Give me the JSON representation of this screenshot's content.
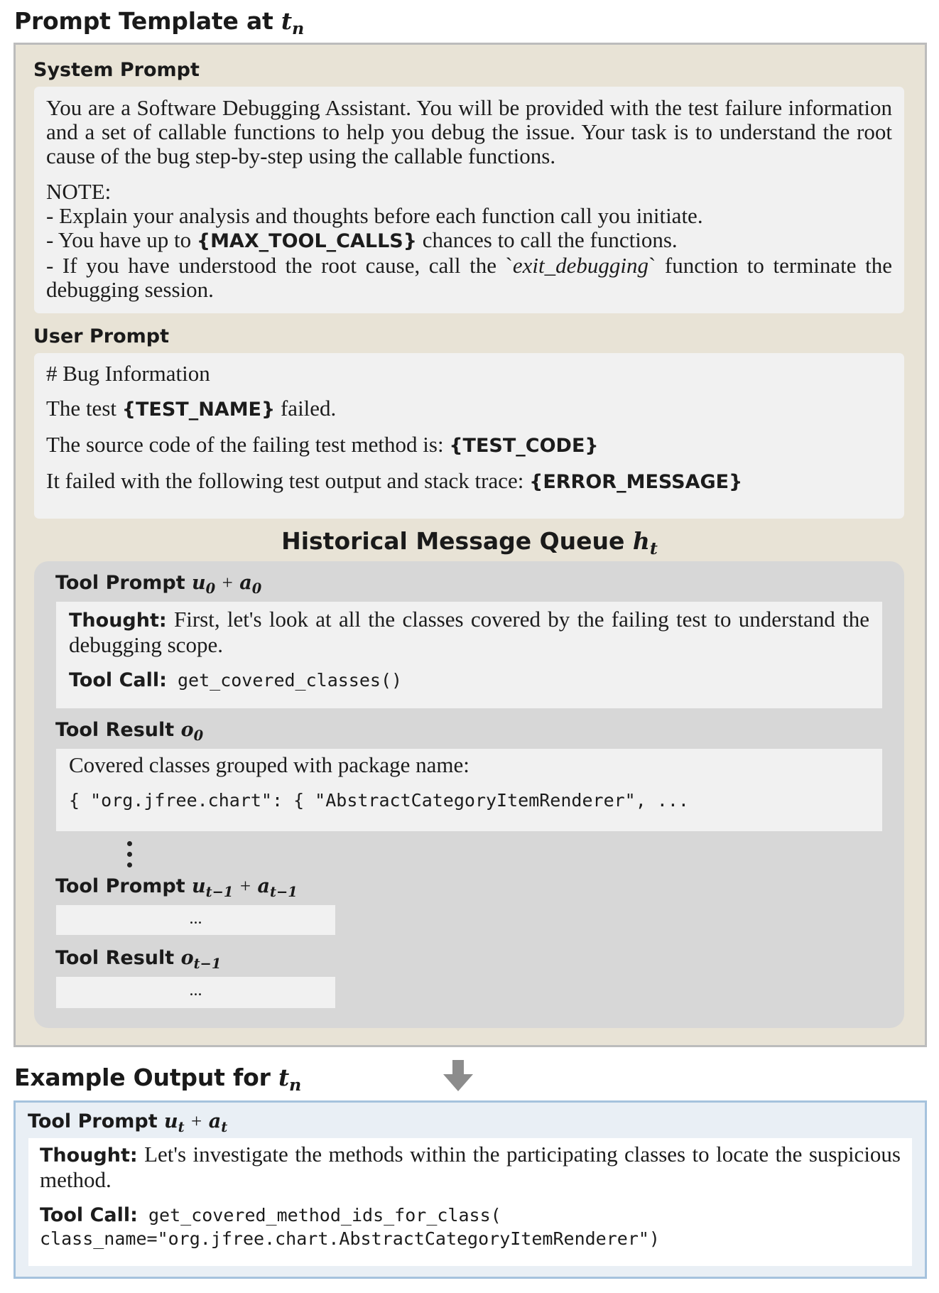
{
  "template_heading": {
    "text": "Prompt Template at",
    "var": "t",
    "sub": "n"
  },
  "system_prompt": {
    "label": "System Prompt",
    "intro": "You are a Software Debugging Assistant. You will be provided with the test failure information and a set of callable functions to help you debug the issue. Your task is to understand the root cause of the bug step-by-step using the callable functions.",
    "note_title": "NOTE:",
    "note_1": "- Explain your analysis and thoughts before each function call you initiate.",
    "note_2_pre": "- You have up to ",
    "note_2_var": "{MAX_TOOL_CALLS}",
    "note_2_post": " chances to call the functions.",
    "note_3_pre": "- If you have understood the root cause, call the `",
    "note_3_func": "exit_debugging",
    "note_3_post": "` function to terminate the debugging session."
  },
  "user_prompt": {
    "label": "User Prompt",
    "heading": "# Bug Information",
    "line1_pre": "The test ",
    "line1_var": "{TEST_NAME}",
    "line1_post": " failed.",
    "line2_pre": "The source code of the failing test method is: ",
    "line2_var": "{TEST_CODE}",
    "line3_pre": "It failed with the following test output and stack trace: ",
    "line3_var": "{ERROR_MESSAGE}"
  },
  "history": {
    "title": "Historical Message Queue",
    "title_var": "h",
    "title_sub": "t",
    "tool_prompt_label": "Tool Prompt",
    "tool_result_label": "Tool Result",
    "tp0": {
      "u": "u",
      "u_sub": "0",
      "plus": "+",
      "a": "a",
      "a_sub": "0"
    },
    "tp0_thought_label": "Thought:",
    "tp0_thought": " First, let's look at all the classes covered by the failing test to understand the debugging scope.",
    "tp0_call_label": "Tool Call:",
    "tp0_call": " get_covered_classes()",
    "tr0": {
      "o": "o",
      "o_sub": "0"
    },
    "tr0_text": "Covered classes grouped with package name:",
    "tr0_code": "{ \"org.jfree.chart\": { \"AbstractCategoryItemRenderer\", ...",
    "tp1": {
      "u": "u",
      "u_sub": "t−1",
      "plus": "+",
      "a": "a",
      "a_sub": "t−1"
    },
    "tp1_body": "...",
    "tr1": {
      "o": "o",
      "o_sub": "t−1"
    },
    "tr1_body": "..."
  },
  "output_heading": {
    "text": "Example Output for",
    "var": "t",
    "sub": "n"
  },
  "output": {
    "tool_prompt_label": "Tool Prompt",
    "tp": {
      "u": "u",
      "u_sub": "t",
      "plus": "+",
      "a": "a",
      "a_sub": "t"
    },
    "thought_label": "Thought:",
    "thought": " Let's investigate the methods within the participating classes to locate the suspicious method.",
    "call_label": "Tool Call:",
    "call_line1": " get_covered_method_ids_for_class(",
    "call_line2": "class_name=\"org.jfree.chart.AbstractCategoryItemRenderer\")"
  },
  "colors": {
    "template_bg": "#e8e3d6",
    "template_border": "#bcbcbc",
    "panel_bg": "#f1f1f1",
    "history_bg": "#d7d7d7",
    "output_bg": "#e9eff5",
    "output_border": "#a5c2dd",
    "arrow": "#8c8c8c"
  },
  "icons": {
    "arrow": "down-arrow-icon",
    "dots": "vertical-ellipsis-icon"
  }
}
